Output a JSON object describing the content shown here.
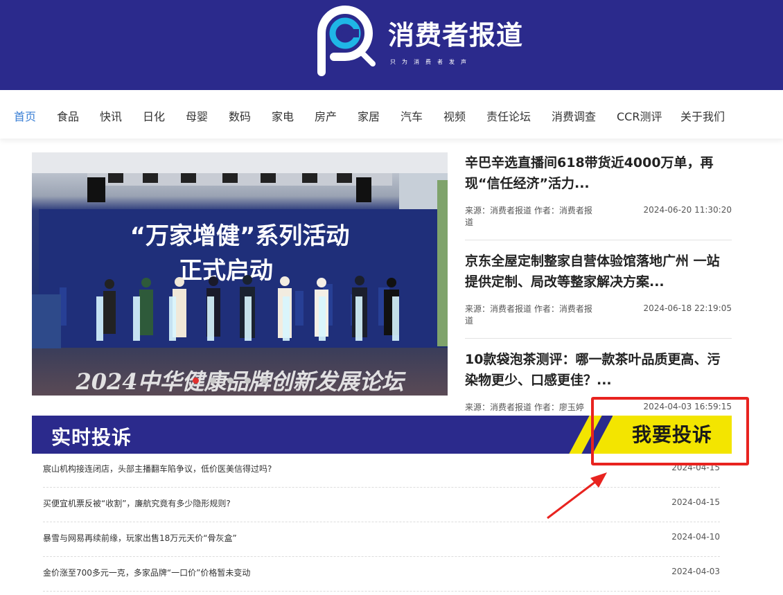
{
  "brand": {
    "name": "消费者报道",
    "slogan": "只为消费者发声",
    "header_color": "#2b2a8c"
  },
  "nav": {
    "items": [
      {
        "label": "首页",
        "active": true
      },
      {
        "label": "食品"
      },
      {
        "label": "快讯"
      },
      {
        "label": "日化"
      },
      {
        "label": "母婴"
      },
      {
        "label": "数码"
      },
      {
        "label": "家电"
      },
      {
        "label": "房产"
      },
      {
        "label": "家居"
      },
      {
        "label": "汽车"
      },
      {
        "label": "视频"
      },
      {
        "label": "责任论坛"
      },
      {
        "label": "消费调查"
      },
      {
        "label": "CCR测评"
      },
      {
        "label": "关于我们"
      }
    ],
    "active_color": "#3a7fd5"
  },
  "hero": {
    "banner_line1": "“万家增健”系列活动",
    "banner_line2": "正式启动",
    "floor_text": "2024中华健康品牌创新发展论坛",
    "slide_count": 5,
    "active_slide": 1
  },
  "news": [
    {
      "title": "辛巴辛选直播间618带货近4000万单，再现“信任经济”活力...",
      "source": "来源：消费者报道 作者：消费者报道",
      "date": "2024-06-20 11:30:20"
    },
    {
      "title": "京东全屋定制整家自营体验馆落地广州 一站提供定制、局改等整家解决方案...",
      "source": "来源：消费者报道 作者：消费者报道",
      "date": "2024-06-18 22:19:05"
    },
    {
      "title": "10款袋泡茶测评：哪一款茶叶品质更高、污染物更少、口感更佳？...",
      "source": "来源：消费者报道 作者：廖玉婷",
      "date": "2024-04-03 16:59:15"
    }
  ],
  "complaints": {
    "section_title": "实时投诉",
    "button_label": "我要投诉",
    "accent_color": "#f3e500",
    "items": [
      {
        "title": "宸山机构接连闭店，头部主播翻车陷争议，低价医美信得过吗?",
        "date": "2024-04-15"
      },
      {
        "title": "买便宜机票反被“收割”，廉航究竟有多少隐形规则?",
        "date": "2024-04-15"
      },
      {
        "title": "暴雪与网易再续前缘，玩家出售18万元天价“骨灰盒”",
        "date": "2024-04-10"
      },
      {
        "title": "金价涨至700多元一克，多家品牌“一口价”价格暂未变动",
        "date": "2024-04-03"
      }
    ]
  },
  "annotation": {
    "highlight_color": "#e8231f"
  }
}
